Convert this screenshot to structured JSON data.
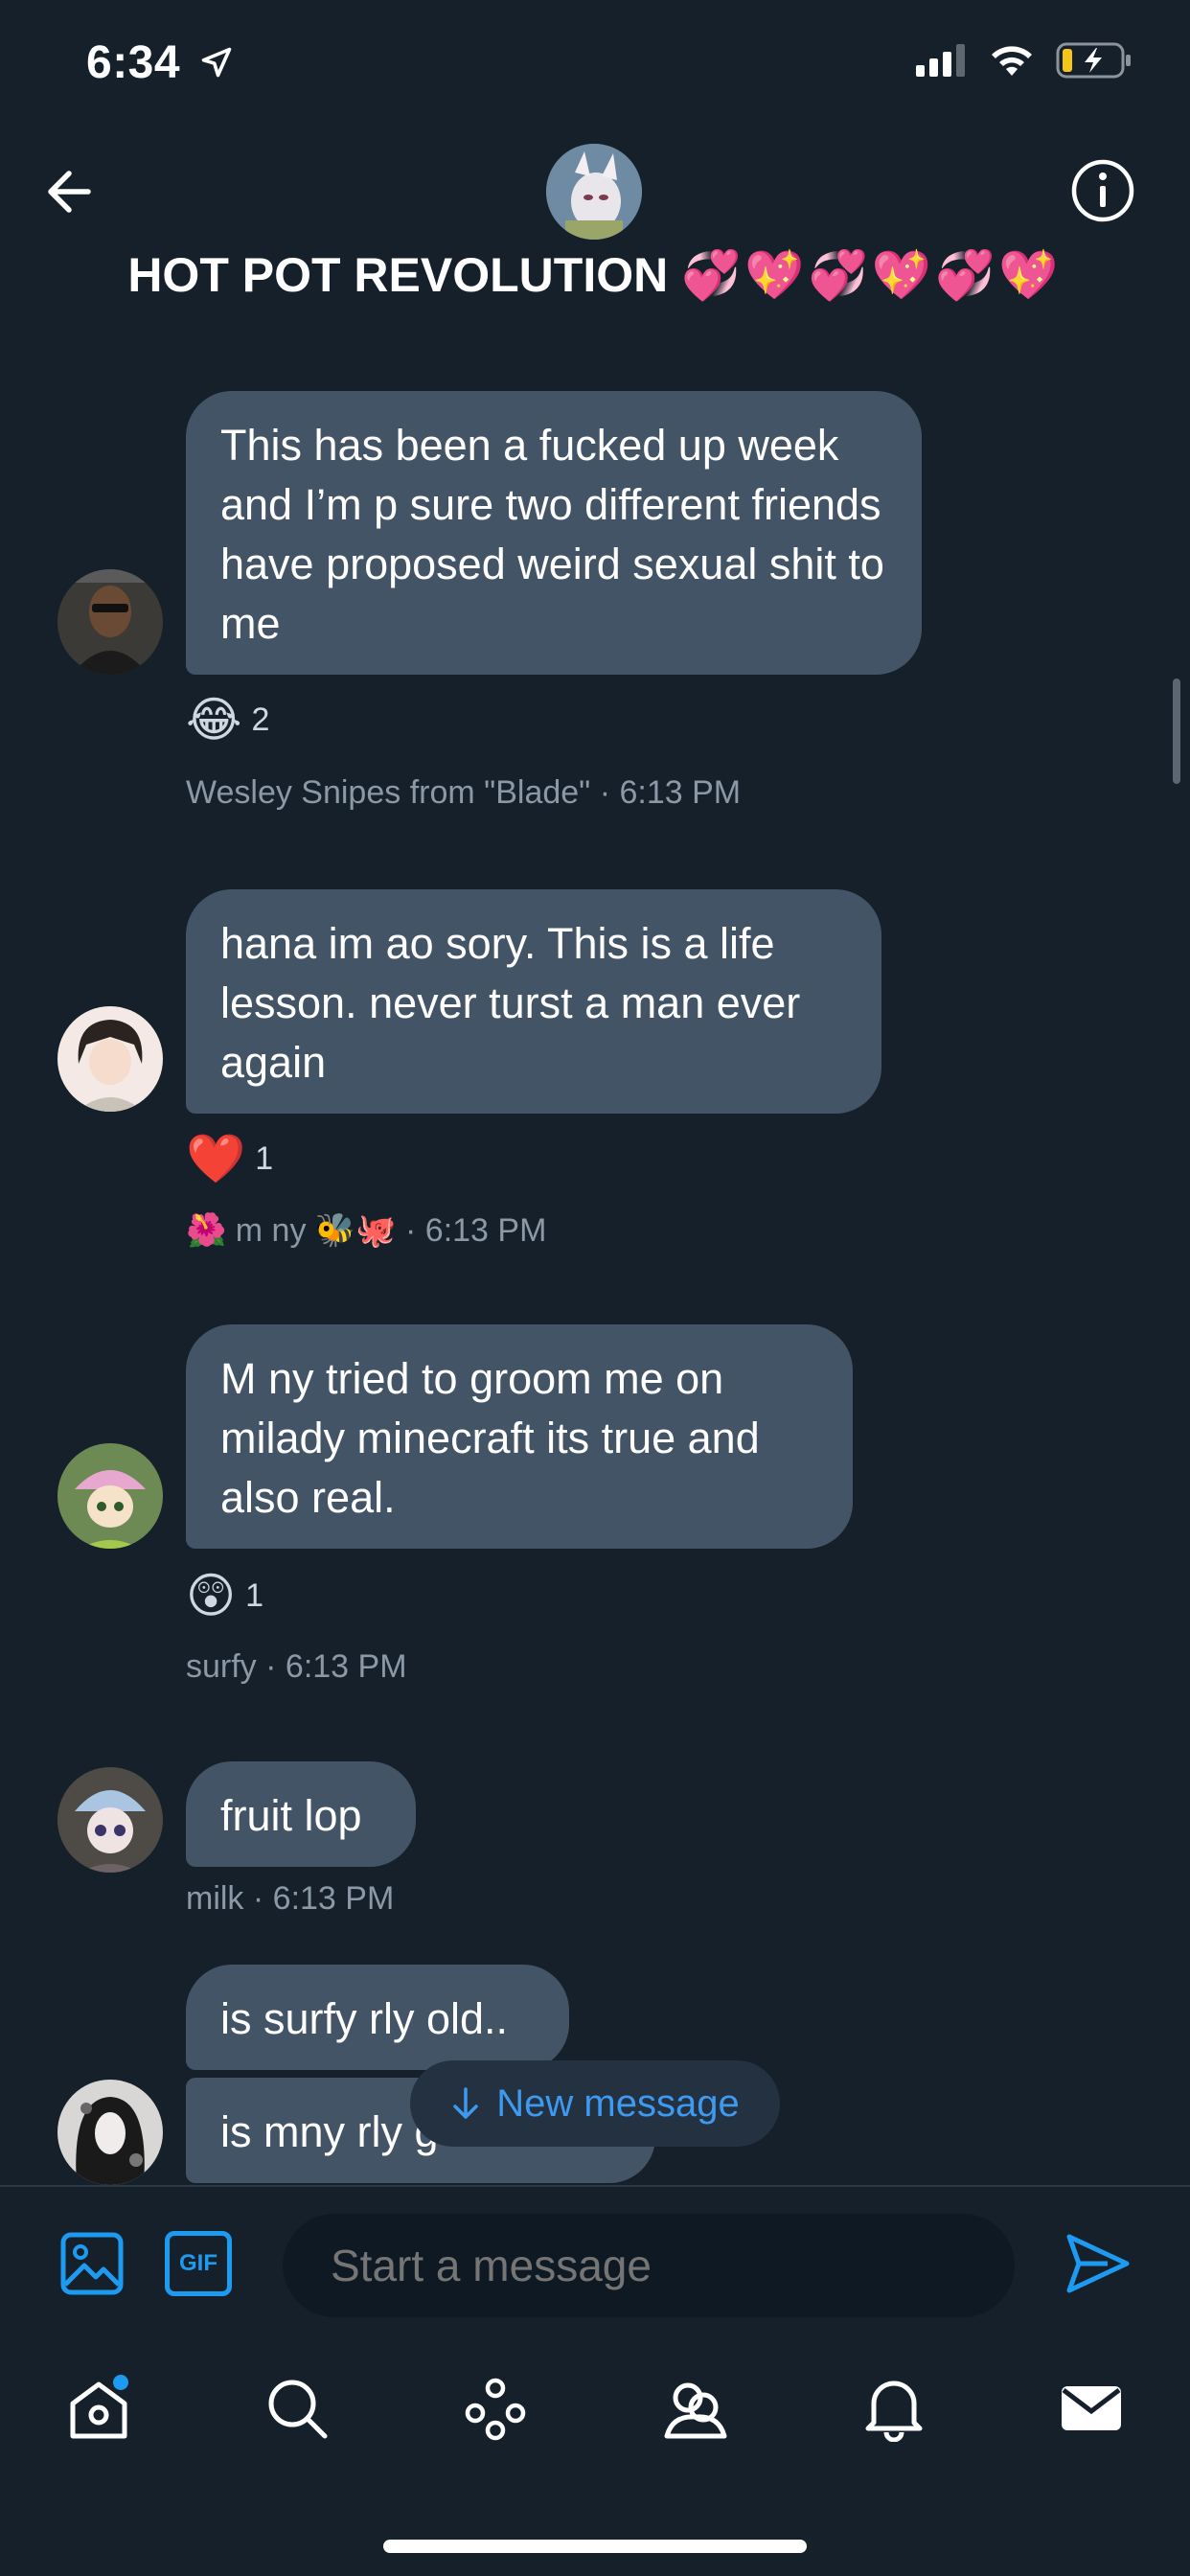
{
  "status": {
    "time": "6:34",
    "location_icon": "location-arrow-icon",
    "signal_icon": "cellular-signal-icon",
    "wifi_icon": "wifi-icon",
    "battery_icon": "battery-charging-icon"
  },
  "header": {
    "title": "HOT POT REVOLUTION",
    "title_emoji": "💞💖💞💖💞💖",
    "back_icon": "back-arrow-icon",
    "info_icon": "info-icon"
  },
  "messages": [
    {
      "text": "This has been a fucked up week and I’m p sure two different friends have proposed weird sexual shit to me",
      "reaction_emoji": "😂",
      "reaction_count": "2",
      "sender": "Wesley Snipes from \"Blade\"",
      "time": "6:13 PM"
    },
    {
      "text": "hana im ao sory. This is a life lesson. never turst a man ever again",
      "reaction_emoji": "❤️",
      "reaction_count": "1",
      "sender": "🌺 m ny 🐝🐙",
      "time": "6:13 PM"
    },
    {
      "text": "M ny tried to groom me on milady minecraft its true and also real.",
      "reaction_emoji": "😲",
      "reaction_count": "1",
      "sender": "surfy",
      "time": "6:13 PM"
    },
    {
      "text": "fruit lop",
      "sender": "milk",
      "time": "6:13 PM"
    },
    {
      "text": "is surfy rly old.."
    },
    {
      "text": "is mny rly g"
    }
  ],
  "meta_separator": " · ",
  "new_message": {
    "label": "New message",
    "icon": "arrow-down-icon"
  },
  "composer": {
    "placeholder": "Start a message",
    "image_icon": "image-icon",
    "gif_label": "GIF",
    "send_icon": "send-icon"
  },
  "tabbar": {
    "items": [
      "home-icon",
      "search-icon",
      "spaces-icon",
      "communities-icon",
      "notifications-icon",
      "messages-icon"
    ],
    "accent_color": "#1d9bf0"
  }
}
